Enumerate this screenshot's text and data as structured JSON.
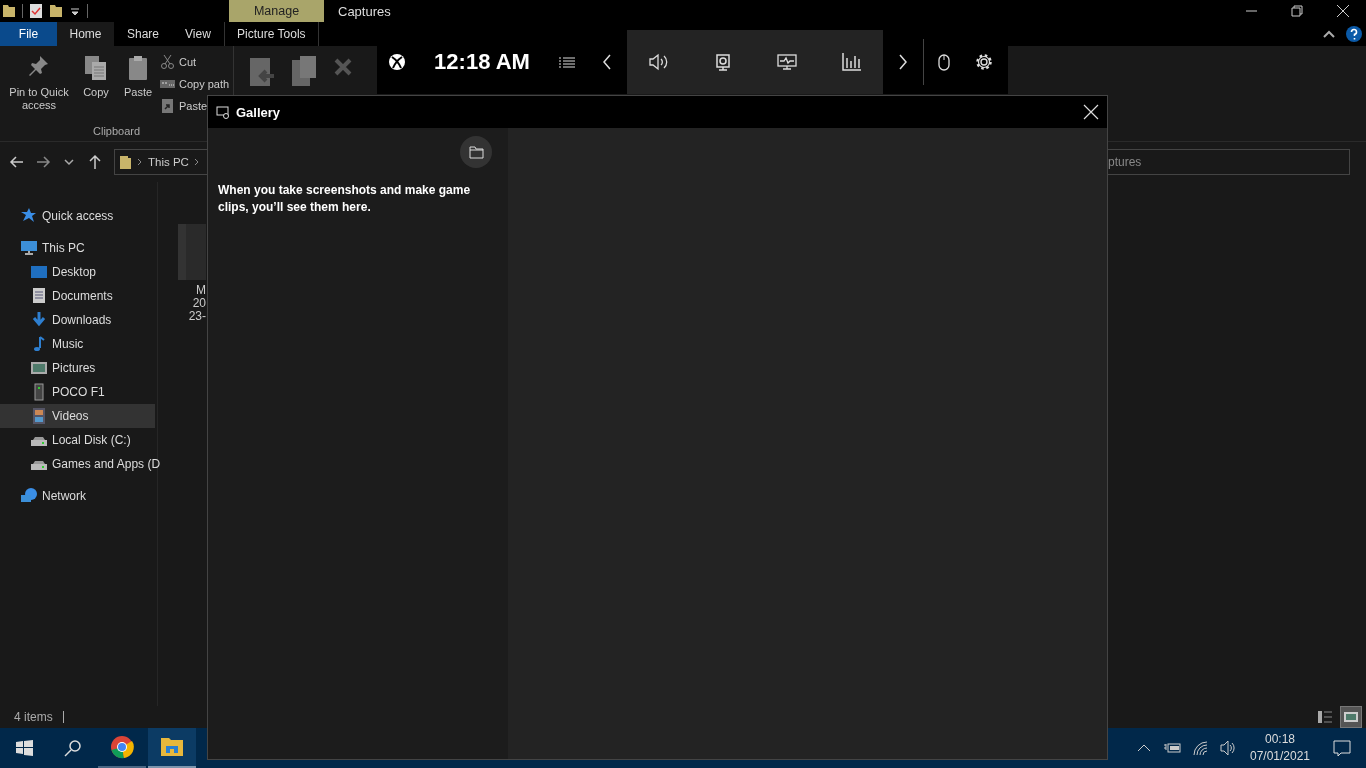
{
  "explorer": {
    "context_tab": "Manage",
    "title": "Captures",
    "ribbon_tabs": [
      {
        "label": "File",
        "kind": "file",
        "selected": false
      },
      {
        "label": "Home",
        "kind": "tab",
        "selected": true
      },
      {
        "label": "Share",
        "kind": "tab",
        "selected": false
      },
      {
        "label": "View",
        "kind": "tab",
        "selected": false
      },
      {
        "label": "Picture Tools",
        "kind": "context",
        "selected": false
      }
    ],
    "clipboard": {
      "large_buttons": [
        {
          "label": "Pin to Quick access",
          "kind": "pin"
        },
        {
          "label": "Copy",
          "kind": "copy"
        },
        {
          "label": "Paste",
          "kind": "paste"
        }
      ],
      "small_buttons": [
        {
          "label": "Cut",
          "kind": "cut"
        },
        {
          "label": "Copy path",
          "kind": "path"
        },
        {
          "label": "Paste",
          "kind": "shortcut"
        }
      ],
      "group_label": "Clipboard"
    },
    "address": {
      "crumbs": [
        "This PC"
      ]
    },
    "search": {
      "placeholder": "ptures"
    },
    "nav": [
      {
        "label": "Quick access",
        "kind": "star",
        "selected": false
      },
      {
        "label": "This PC",
        "kind": "pc",
        "selected": false,
        "children": [
          {
            "label": "Desktop",
            "kind": "desktop",
            "selected": false
          },
          {
            "label": "Documents",
            "kind": "documents",
            "selected": false
          },
          {
            "label": "Downloads",
            "kind": "downloads",
            "selected": false
          },
          {
            "label": "Music",
            "kind": "music",
            "selected": false
          },
          {
            "label": "Pictures",
            "kind": "pictures",
            "selected": false
          },
          {
            "label": "POCO F1",
            "kind": "phone",
            "selected": false
          },
          {
            "label": "Videos",
            "kind": "videos",
            "selected": true
          },
          {
            "label": "Local Disk (C:)",
            "kind": "drive",
            "selected": false
          },
          {
            "label": "Games and Apps (D",
            "kind": "drive",
            "selected": false
          }
        ]
      },
      {
        "label": "Network",
        "kind": "network",
        "selected": false
      }
    ],
    "file": {
      "lines": [
        "M",
        "20",
        "23-"
      ]
    },
    "status": "4 items",
    "views": [
      {
        "kind": "details",
        "selected": false
      },
      {
        "kind": "large",
        "selected": true
      }
    ]
  },
  "game_bar": {
    "time": "12:18 AM"
  },
  "gallery": {
    "title": "Gallery",
    "message": "When you take screenshots and make game clips, you’ll see them here."
  },
  "taskbar": {
    "apps": [
      {
        "kind": "chrome",
        "selected": false
      },
      {
        "kind": "explorer",
        "selected": true
      }
    ],
    "clock": "00:18",
    "date": "07/01/2021"
  }
}
